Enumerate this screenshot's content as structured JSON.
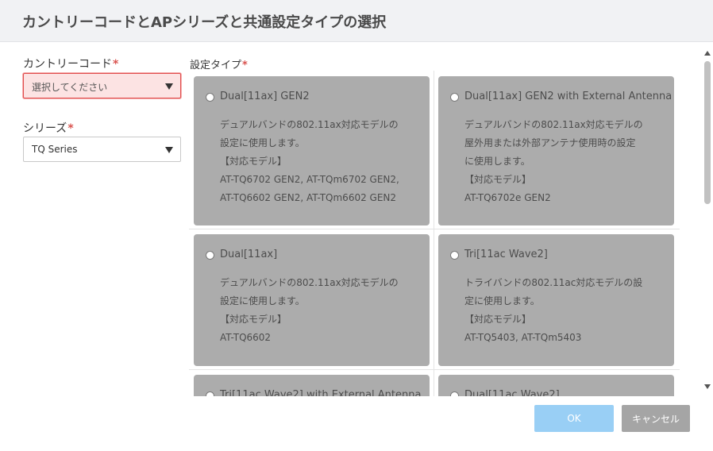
{
  "dialog": {
    "title": "カントリーコードとAPシリーズと共通設定タイプの選択"
  },
  "country_code": {
    "label": "カントリーコード",
    "required_mark": "*",
    "value": "選択してください"
  },
  "series": {
    "label": "シリーズ",
    "required_mark": "*",
    "value": "TQ Series"
  },
  "setting_type": {
    "label": "設定タイプ",
    "required_mark": "*",
    "options": [
      {
        "title": "Dual[11ax] GEN2",
        "lines": [
          "デュアルバンドの802.11ax対応モデルの",
          "設定に使用します。",
          "【対応モデル】",
          "AT-TQ6702 GEN2, AT-TQm6702 GEN2,",
          "AT-TQ6602 GEN2, AT-TQm6602 GEN2"
        ]
      },
      {
        "title": "Dual[11ax] GEN2 with External Antenna",
        "lines": [
          "デュアルバンドの802.11ax対応モデルの",
          "屋外用または外部アンテナ使用時の設定",
          "に使用します。",
          "【対応モデル】",
          "AT-TQ6702e GEN2"
        ]
      },
      {
        "title": "Dual[11ax]",
        "lines": [
          "デュアルバンドの802.11ax対応モデルの",
          "設定に使用します。",
          "【対応モデル】",
          "AT-TQ6602"
        ]
      },
      {
        "title": "Tri[11ac Wave2]",
        "lines": [
          "トライバンドの802.11ac対応モデルの設",
          "定に使用します。",
          "【対応モデル】",
          "AT-TQ5403, AT-TQm5403"
        ]
      },
      {
        "title": "Tri[11ac Wave2] with External Antenna",
        "lines": []
      },
      {
        "title": "Dual[11ac Wave2]",
        "lines": []
      }
    ]
  },
  "buttons": {
    "ok": "OK",
    "cancel": "キャンセル"
  },
  "colors": {
    "card_bg": "#acacac",
    "error_bg": "#fce3e3",
    "error_border": "#e04b4b",
    "ok_button": "#99cff5",
    "cancel_button": "#a5a5a5",
    "required": "#d9534f"
  }
}
